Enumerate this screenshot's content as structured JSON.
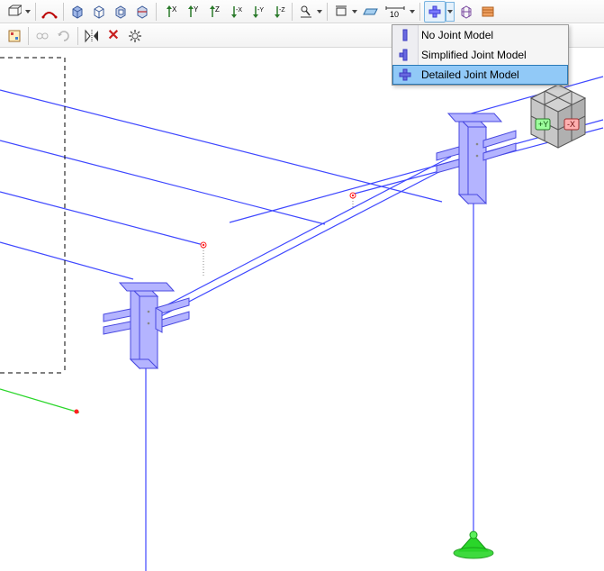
{
  "toolbar1": {
    "icons": [
      "isometric-icon",
      "dropdown-arrow-icon",
      "separator",
      "section-icon",
      "separator",
      "box-view-icon",
      "box-wire-icon",
      "box-cut-icon",
      "box-slice-icon",
      "separator",
      "axis-x-icon",
      "axis-y-icon",
      "axis-z-icon",
      "axis-neg-x-icon",
      "axis-neg-y-icon",
      "axis-neg-z-icon",
      "separator",
      "microscope-icon",
      "dropdown-arrow-icon",
      "separator",
      "box-select-icon",
      "dropdown-arrow-icon",
      "plane-icon",
      "dim-10-icon",
      "dropdown-arrow-icon",
      "separator",
      "joint-model-icon",
      "dropdown-arrow-icon",
      "grid-3d-icon",
      "stack-icon"
    ]
  },
  "toolbar2": {
    "icons": [
      "render-icon",
      "separator",
      "link-icon",
      "rotate-icon",
      "separator",
      "mirror-icon",
      "delete-icon",
      "gear-icon"
    ]
  },
  "dropdown": {
    "items": [
      {
        "label": "No Joint Model",
        "icon": "joint-none-icon",
        "selected": false
      },
      {
        "label": "Simplified Joint Model",
        "icon": "joint-simple-icon",
        "selected": false
      },
      {
        "label": "Detailed Joint Model",
        "icon": "joint-detail-icon",
        "selected": true
      }
    ]
  },
  "axis_gizmo": {
    "y_label": "+Y",
    "x_label": "-X"
  },
  "colors": {
    "accent": "#3f48ff",
    "struct_fill": "#b4b4ff",
    "struct_stroke": "#4848e0",
    "support": "#2ad62a",
    "node_red": "#ff2020",
    "highlight": "#91c9f7"
  }
}
